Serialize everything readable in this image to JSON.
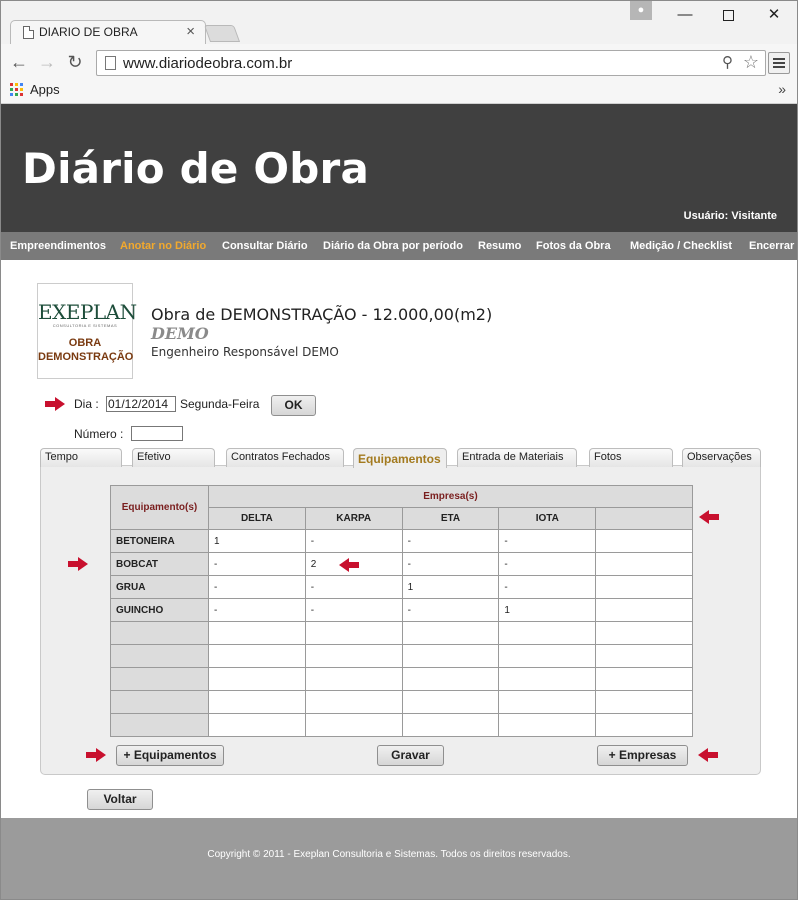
{
  "browser": {
    "tab_title": "DIARIO DE OBRA",
    "tab_close": "×",
    "url": "www.diariodeobra.com.br",
    "bookmarks_apps": "Apps",
    "bookmarks_more": "»",
    "win_min": "—",
    "win_close": "✕"
  },
  "header": {
    "title": "Diário de Obra",
    "user": "Usuário: Visitante"
  },
  "nav": {
    "items": [
      {
        "label": "Empreendimentos"
      },
      {
        "label": "Anotar no Diário",
        "active": true
      },
      {
        "label": "Consultar Diário"
      },
      {
        "label": "Diário da Obra por período"
      },
      {
        "label": "Resumo"
      },
      {
        "label": "Fotos da Obra"
      },
      {
        "label": "Medição / Checklist"
      },
      {
        "label": "Encerrar"
      }
    ]
  },
  "logo": {
    "brand": "EXEPLAN",
    "tagline": "CONSULTORIA E SISTEMAS",
    "line1": "OBRA",
    "line2": "DEMONSTRAÇÃO"
  },
  "obra": {
    "title": "Obra de DEMONSTRAÇÃO - 12.000,00(m2)",
    "code": "DEMO",
    "engineer": "Engenheiro Responsável DEMO"
  },
  "form": {
    "dia_label": "Dia :",
    "dia_value": "01/12/2014",
    "weekday": "Segunda-Feira",
    "ok_label": "OK",
    "numero_label": "Número :",
    "numero_value": ""
  },
  "tabs": [
    {
      "label": "Tempo"
    },
    {
      "label": "Efetivo"
    },
    {
      "label": "Contratos Fechados"
    },
    {
      "label": "Equipamentos",
      "active": true
    },
    {
      "label": "Entrada de Materiais"
    },
    {
      "label": "Fotos"
    },
    {
      "label": "Observações"
    }
  ],
  "grid": {
    "corner_header": "Equipamento(s)",
    "group_header": "Empresa(s)",
    "columns": [
      "DELTA",
      "KARPA",
      "ETA",
      "IOTA",
      ""
    ],
    "rows": [
      {
        "name": "BETONEIRA",
        "values": [
          "1",
          "-",
          "-",
          "-",
          ""
        ]
      },
      {
        "name": "BOBCAT",
        "values": [
          "-",
          "2",
          "-",
          "-",
          ""
        ]
      },
      {
        "name": "GRUA",
        "values": [
          "-",
          "-",
          "1",
          "-",
          ""
        ]
      },
      {
        "name": "GUINCHO",
        "values": [
          "-",
          "-",
          "-",
          "1",
          ""
        ]
      },
      {
        "name": "",
        "values": [
          "",
          "",
          "",
          "",
          ""
        ]
      },
      {
        "name": "",
        "values": [
          "",
          "",
          "",
          "",
          ""
        ]
      },
      {
        "name": "",
        "values": [
          "",
          "",
          "",
          "",
          ""
        ]
      },
      {
        "name": "",
        "values": [
          "",
          "",
          "",
          "",
          ""
        ]
      },
      {
        "name": "",
        "values": [
          "",
          "",
          "",
          "",
          ""
        ]
      }
    ]
  },
  "actions": {
    "add_equip": "+ Equipamentos",
    "save": "Gravar",
    "add_emp": "+ Empresas",
    "back": "Voltar"
  },
  "footer": {
    "copyright": "Copyright © 2011 - Exeplan Consultoria e Sistemas. Todos os direitos reservados."
  },
  "colors": {
    "header_bg": "#404040",
    "nav_bg": "#7a7a7a",
    "nav_active": "#f2a92d",
    "arrow_red": "#c8102e",
    "footer_bg": "#9b9b9b"
  }
}
